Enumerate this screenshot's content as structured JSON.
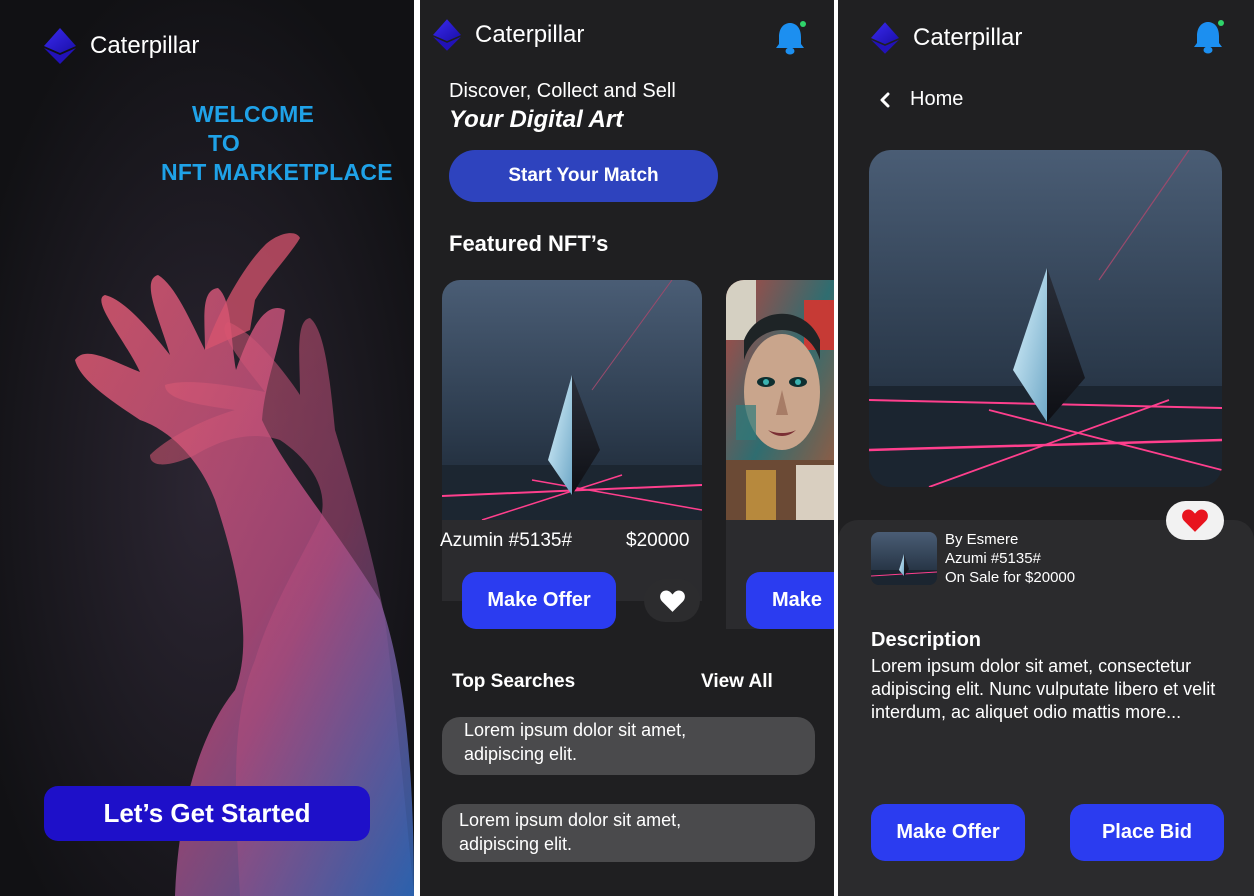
{
  "brand": {
    "name": "Caterpillar",
    "logo_icon": "ethereum-diamond-icon",
    "logo_color": "#2a1ad6"
  },
  "welcome_screen": {
    "line1": "WELCOME",
    "line2": "TO",
    "line3": "NFT MARKETPLACE",
    "cta_label": "Let’s Get Started",
    "accent_color": "#1fa2e8"
  },
  "home_screen": {
    "notification_icon": "bell-icon",
    "tagline_top": "Discover, Collect and Sell",
    "tagline_bottom": "Your Digital Art",
    "start_label": "Start Your Match",
    "featured_title": "Featured NFT’s",
    "cards": [
      {
        "name": "Azumin #5135#",
        "price": "$20000",
        "offer_label": "Make Offer"
      },
      {
        "offer_label": "Make"
      }
    ],
    "top_searches_label": "Top Searches",
    "view_all_label": "View All",
    "searches": [
      {
        "line1": "Lorem ipsum dolor sit amet,",
        "line2": "adipiscing elit."
      },
      {
        "line1": "Lorem ipsum dolor sit amet,",
        "line2": "adipiscing elit."
      }
    ]
  },
  "detail_screen": {
    "back_label": "Home",
    "author": "By Esmere",
    "item": "Azumi #5135#",
    "sale": "On Sale for $20000",
    "description_title": "Description",
    "description_body": "Lorem ipsum dolor sit amet, consectetur adipiscing elit. Nunc vulputate libero et velit interdum, ac aliquet odio mattis more...",
    "offer_label": "Make Offer",
    "bid_label": "Place Bid",
    "button_color": "#2b3cf0",
    "like_color": "#e8141e"
  }
}
